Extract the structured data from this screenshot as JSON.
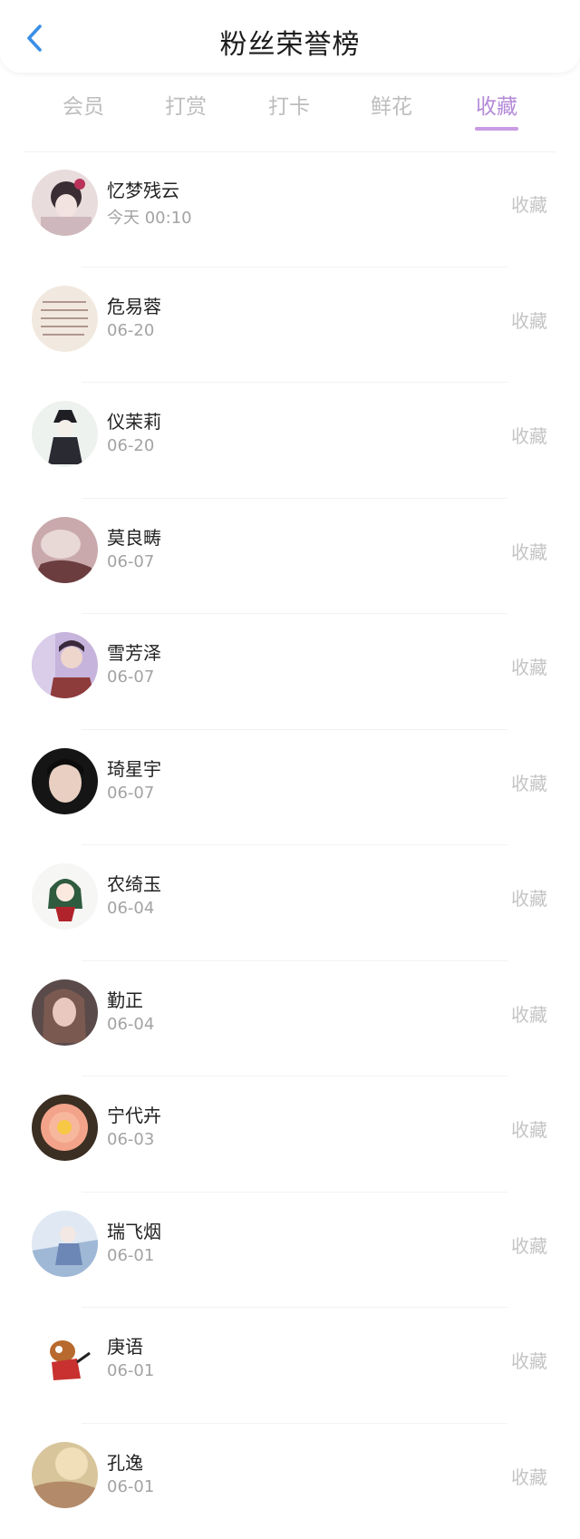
{
  "header": {
    "title": "粉丝荣誉榜",
    "back_icon": "chevron-left-icon",
    "back_color": "#3a8ee6"
  },
  "tabs": [
    {
      "label": "会员",
      "active": false
    },
    {
      "label": "打赏",
      "active": false
    },
    {
      "label": "打卡",
      "active": false
    },
    {
      "label": "鲜花",
      "active": false
    },
    {
      "label": "收藏",
      "active": true
    }
  ],
  "accent_color": "#b48ad8",
  "fans": [
    {
      "name": "忆梦残云",
      "date": "今天 00:10",
      "action": "收藏"
    },
    {
      "name": "危易蓉",
      "date": "06-20",
      "action": "收藏"
    },
    {
      "name": "仪茉莉",
      "date": "06-20",
      "action": "收藏"
    },
    {
      "name": "莫良畴",
      "date": "06-07",
      "action": "收藏"
    },
    {
      "name": "雪芳泽",
      "date": "06-07",
      "action": "收藏"
    },
    {
      "name": "琦星宇",
      "date": "06-07",
      "action": "收藏"
    },
    {
      "name": "农绮玉",
      "date": "06-04",
      "action": "收藏"
    },
    {
      "name": "勤正",
      "date": "06-04",
      "action": "收藏"
    },
    {
      "name": "宁代卉",
      "date": "06-03",
      "action": "收藏"
    },
    {
      "name": "瑞飞烟",
      "date": "06-01",
      "action": "收藏"
    },
    {
      "name": "庚语",
      "date": "06-01",
      "action": "收藏"
    },
    {
      "name": "孔逸",
      "date": "06-01",
      "action": "收藏"
    }
  ]
}
